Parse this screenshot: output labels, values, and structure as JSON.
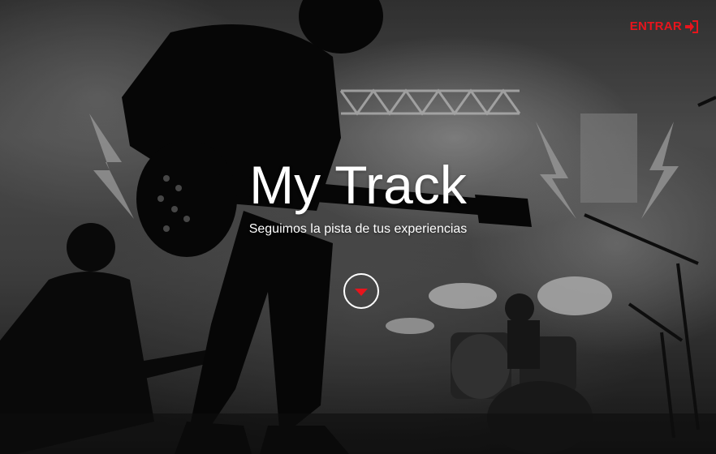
{
  "header": {
    "login_label": "ENTRAR",
    "login_icon": "sign-in-icon"
  },
  "hero": {
    "title": "My Track",
    "subtitle": "Seguimos la pista de tus experiencias",
    "scroll_icon": "chevron-down-icon",
    "background": "black-and-white concert photo"
  },
  "colors": {
    "accent": "#e8141c",
    "text": "#ffffff"
  }
}
